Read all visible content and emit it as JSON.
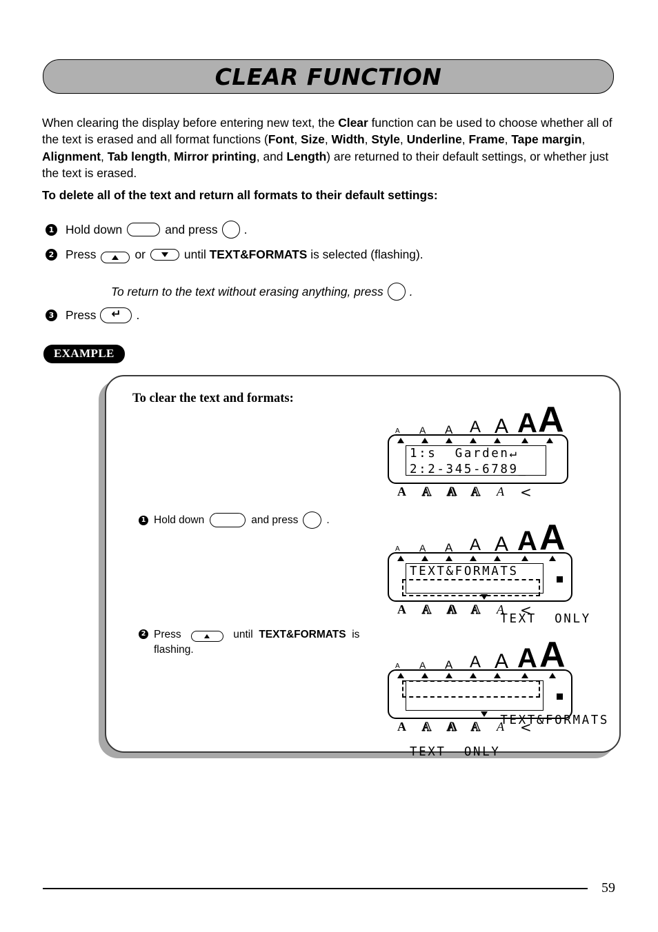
{
  "page": {
    "title": "CLEAR FUNCTION",
    "number": "59"
  },
  "intro": {
    "line1_a": "When clearing the display before entering new text, the ",
    "clear_bold": "Clear",
    "line1_b": " function can be used to choose whether all of the text is erased and all format functions (",
    "formats": [
      "Font",
      "Size",
      "Width",
      "Style",
      "Underline",
      "Frame",
      "Tape margin",
      "Alignment",
      "Tab length",
      "Mirror printing",
      "Length"
    ],
    "line_end": ") are returned to their default settings, or whether just the text is erased.",
    "and_word": ", and ",
    "lead_in": "To delete all of the text and return all formats to their default settings:"
  },
  "steps": {
    "s1": {
      "num": "1",
      "text_a": "Hold down",
      "text_b": "and press",
      "text_c": "."
    },
    "s2": {
      "num": "2",
      "text_a": "Press",
      "text_b": "or",
      "text_c": "until",
      "bold": "TEXT&FORMATS",
      "text_d": "is selected (flashing)."
    },
    "note": {
      "text_a": "To return to the text without erasing anything, press",
      "text_b": "."
    },
    "s3": {
      "num": "3",
      "text_a": "Press",
      "text_b": "."
    }
  },
  "example": {
    "badge": "EXAMPLE",
    "heading": "To clear the text and formats:",
    "step1": {
      "num": "1",
      "text_a": "Hold down",
      "text_b": "and press",
      "text_c": "."
    },
    "step2": {
      "num": "2",
      "text_a": "Press",
      "text_b": "until",
      "bold": "TEXT&FORMATS",
      "text_c": "is",
      "text_d": "flashing."
    }
  },
  "lcd": {
    "size_indicators": [
      "A",
      "A",
      "A",
      "A",
      "A",
      "A",
      "A"
    ],
    "style_indicators": [
      "A",
      "A",
      "A",
      "A",
      "A",
      "<"
    ],
    "display1": {
      "line1_label": "1:",
      "line1_text": "s  Garden↵",
      "line2_label": "2:",
      "line2_text": "2-345-6789_"
    },
    "display2": {
      "line1_text": "TEXT&FORMATS",
      "line2_text": "TEXT  ONLY",
      "flashing_line": "2"
    },
    "display3": {
      "line1_text": "TEXT&FORMATS",
      "line2_text": "TEXT  ONLY",
      "flashing_line": "1"
    }
  }
}
